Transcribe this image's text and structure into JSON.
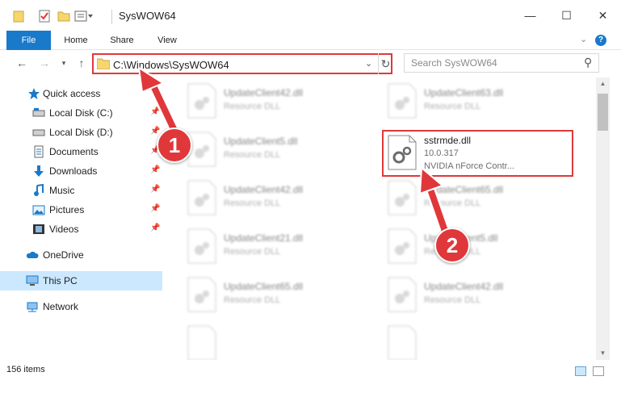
{
  "window": {
    "title": "SysWOW64",
    "minimize_glyph": "—",
    "maximize_glyph": "☐",
    "close_glyph": "✕"
  },
  "ribbon": {
    "tabs": [
      "File",
      "Home",
      "Share",
      "View"
    ],
    "expand_glyph": "⌄",
    "help_glyph": "?"
  },
  "address_bar": {
    "path": "C:\\Windows\\SysWOW64",
    "search_placeholder": "Search SysWOW64"
  },
  "sidebar": {
    "items": [
      {
        "label": "Quick access",
        "icon": "star-icon",
        "pinned": false
      },
      {
        "label": "Local Disk (C:)",
        "icon": "drive-icon",
        "pinned": true
      },
      {
        "label": "Local Disk (D:)",
        "icon": "drive-icon",
        "pinned": true
      },
      {
        "label": "Documents",
        "icon": "documents-icon",
        "pinned": true
      },
      {
        "label": "Downloads",
        "icon": "download-icon",
        "pinned": true
      },
      {
        "label": "Music",
        "icon": "music-icon",
        "pinned": true
      },
      {
        "label": "Pictures",
        "icon": "pictures-icon",
        "pinned": true
      },
      {
        "label": "Videos",
        "icon": "videos-icon",
        "pinned": true
      },
      {
        "label": "OneDrive",
        "icon": "cloud-icon",
        "pinned": false
      },
      {
        "label": "This PC",
        "icon": "computer-icon",
        "pinned": false,
        "selected": true
      },
      {
        "label": "Network",
        "icon": "network-icon",
        "pinned": false
      }
    ]
  },
  "files": {
    "left_column": [
      {
        "name": "UpdateClient42.dll",
        "type": "Resource DLL"
      },
      {
        "name": "UpdateClient5.dll",
        "type": "Resource DLL"
      },
      {
        "name": "UpdateClient42.dll",
        "type": "Resource DLL"
      },
      {
        "name": "UpdateClient21.dll",
        "type": "Resource DLL"
      },
      {
        "name": "UpdateClient65.dll",
        "type": "Resource DLL"
      }
    ],
    "right_column": [
      {
        "name": "UpdateClient63.dll",
        "type": "Resource DLL"
      },
      {
        "name": "UpdateClient65.dll",
        "type": "Resource DLL"
      },
      {
        "name": "UpdateClient5.dll",
        "type": "Resource DLL"
      },
      {
        "name": "UpdateClient42.dll",
        "type": "Resource DLL"
      }
    ],
    "highlighted": {
      "name": "sstrmde.dll",
      "version": "10.0.317",
      "description": "NVIDIA nForce Contr..."
    }
  },
  "status": {
    "item_count": "156 items"
  },
  "annotations": {
    "marker_1": "1",
    "marker_2": "2",
    "accent_color": "#e0383a"
  }
}
